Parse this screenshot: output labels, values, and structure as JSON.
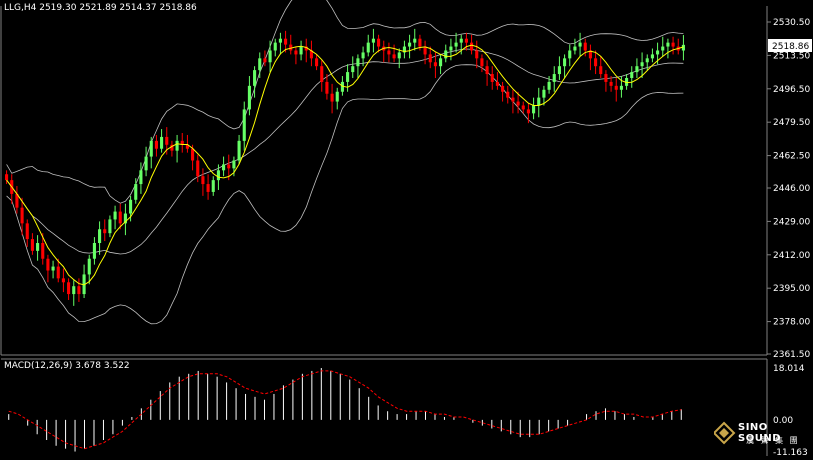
{
  "header": {
    "symbol": "LLG,H4",
    "open": "2519.30",
    "high": "2521.89",
    "low": "2514.37",
    "close": "2518.86"
  },
  "price_axis": {
    "ticks": [
      "2530.50",
      "2513.50",
      "2496.50",
      "2479.50",
      "2462.50",
      "2446.00",
      "2429.00",
      "2412.00",
      "2395.00",
      "2378.00",
      "2361.50"
    ],
    "current_price": "2518.86"
  },
  "macd": {
    "label": "MACD(12,26,9)",
    "main": "3.678",
    "signal": "3.522",
    "ticks": [
      "18.014",
      "0.00",
      "-11.163"
    ]
  },
  "logo": {
    "name": "SINO SOUND",
    "subtitle": "漢 聲 集 團"
  },
  "colors": {
    "background": "#000000",
    "bull_candle": "#66ff66",
    "bear_candle": "#ff0000",
    "ma_line": "#ffff00",
    "bands": "#c0c0c0",
    "macd_histogram": "#ffffff",
    "macd_signal": "#ff0000"
  },
  "chart_data": [
    {
      "type": "candlestick",
      "title": "LLG,H4",
      "ylim": [
        2361.5,
        2530.5
      ],
      "indicators": [
        "Bollinger Bands",
        "moving average"
      ],
      "grid": false,
      "closes": [
        2450,
        2443,
        2436,
        2428,
        2420,
        2414,
        2418,
        2410,
        2404,
        2406,
        2400,
        2398,
        2392,
        2396,
        2392,
        2402,
        2410,
        2418,
        2425,
        2423,
        2430,
        2434,
        2428,
        2433,
        2440,
        2448,
        2455,
        2462,
        2470,
        2466,
        2472,
        2468,
        2465,
        2470,
        2468,
        2466,
        2460,
        2452,
        2448,
        2444,
        2450,
        2455,
        2458,
        2456,
        2460,
        2470,
        2486,
        2498,
        2506,
        2512,
        2510,
        2516,
        2520,
        2522,
        2519,
        2516,
        2514,
        2518,
        2516,
        2512,
        2508,
        2500,
        2494,
        2490,
        2495,
        2500,
        2505,
        2508,
        2512,
        2515,
        2520,
        2522,
        2518,
        2516,
        2514,
        2512,
        2515,
        2518,
        2520,
        2522,
        2518,
        2514,
        2510,
        2508,
        2512,
        2516,
        2518,
        2520,
        2522,
        2520,
        2516,
        2512,
        2508,
        2504,
        2500,
        2498,
        2495,
        2492,
        2490,
        2488,
        2486,
        2484,
        2488,
        2492,
        2496,
        2500,
        2504,
        2508,
        2512,
        2516,
        2518,
        2520,
        2516,
        2512,
        2508,
        2504,
        2500,
        2498,
        2496,
        2498,
        2502,
        2505,
        2508,
        2510,
        2512,
        2514,
        2516,
        2518,
        2520,
        2518,
        2516,
        2518.86
      ]
    },
    {
      "type": "bar+line",
      "title": "MACD(12,26,9)",
      "ylim": [
        -11.163,
        18.014
      ],
      "series": [
        {
          "name": "main",
          "type": "bar",
          "values": [
            2,
            0,
            -2,
            -5,
            -7,
            -9,
            -10,
            -11,
            -10,
            -9,
            -7,
            -5,
            -2,
            1,
            4,
            7,
            10,
            13,
            15,
            16,
            17,
            16,
            15,
            13,
            11,
            9,
            8,
            7,
            9,
            12,
            14,
            16,
            17,
            18,
            17,
            16,
            14,
            11,
            8,
            5,
            3,
            2,
            2,
            3,
            3,
            2,
            1,
            1,
            0,
            -1,
            -2,
            -3,
            -4,
            -5,
            -6,
            -6,
            -5,
            -4,
            -3,
            -2,
            0,
            2,
            3,
            4,
            3,
            2,
            1,
            0,
            1,
            2,
            3,
            3.678
          ]
        },
        {
          "name": "signal",
          "type": "line",
          "values": [
            3,
            2,
            0,
            -2,
            -4,
            -6,
            -8,
            -9,
            -10,
            -9,
            -8,
            -6,
            -4,
            -1,
            2,
            5,
            8,
            11,
            13,
            15,
            16,
            16,
            16,
            15,
            13,
            11,
            10,
            9,
            10,
            11,
            13,
            15,
            16,
            17,
            17,
            16,
            15,
            13,
            11,
            8,
            6,
            4,
            3,
            3,
            3,
            2,
            2,
            1,
            1,
            0,
            -1,
            -2,
            -3,
            -4,
            -5,
            -5,
            -5,
            -4,
            -3,
            -2,
            -1,
            0,
            2,
            3,
            3,
            2,
            2,
            1,
            1,
            2,
            3,
            3.522
          ]
        }
      ]
    }
  ]
}
